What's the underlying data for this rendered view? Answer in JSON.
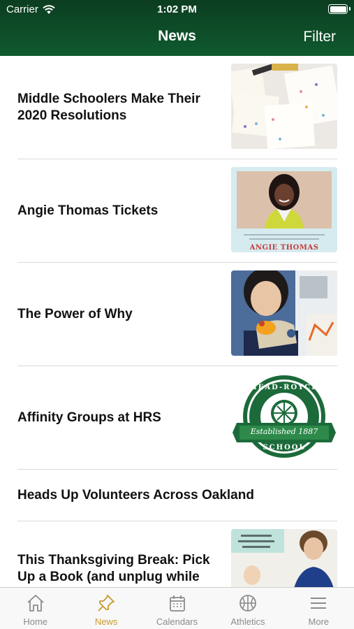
{
  "status": {
    "carrier": "Carrier",
    "time": "1:02 PM"
  },
  "nav": {
    "title": "News",
    "filter_label": "Filter"
  },
  "articles": [
    {
      "title": "Middle Schoolers Make Their 2020 Resolutions",
      "thumb": "resolutions-cards-image"
    },
    {
      "title": "Angie Thomas Tickets",
      "thumb": "author-photo-image",
      "thumb_caption": "ANGIE THOMAS"
    },
    {
      "title": "The Power of Why",
      "thumb": "student-with-puppet-image"
    },
    {
      "title": "Affinity Groups at HRS",
      "thumb": "school-seal-logo",
      "seal_top": "HEAD-ROYCE",
      "seal_bottom": "SCHOOL",
      "seal_banner": "Established 1887"
    },
    {
      "title": "Heads Up Volunteers Across Oakland"
    },
    {
      "title": "This Thanksgiving Break: Pick Up a Book (and unplug while you are at it…)",
      "thumb": "reading-blog-image"
    }
  ],
  "tabs": [
    {
      "label": "Home",
      "icon": "home-icon"
    },
    {
      "label": "News",
      "icon": "pushpin-icon",
      "active": true
    },
    {
      "label": "Calendars",
      "icon": "calendar-icon"
    },
    {
      "label": "Athletics",
      "icon": "basketball-icon"
    },
    {
      "label": "More",
      "icon": "menu-icon"
    }
  ],
  "colors": {
    "header": "#0f5a2f",
    "accent": "#c99a2e",
    "tab_inactive": "#8b8b8b"
  }
}
